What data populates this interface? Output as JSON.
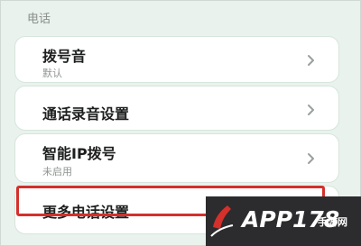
{
  "section": {
    "title": "电话"
  },
  "settings": [
    {
      "title": "拨号音",
      "subtitle": "默认"
    },
    {
      "title": "通话录音设置"
    },
    {
      "title": "智能IP拨号",
      "subtitle": "未启用"
    },
    {
      "title": "更多电话设置"
    }
  ],
  "icons": {
    "chevron": "chevron-right-icon"
  },
  "colors": {
    "background": "#e9f2ed",
    "card": "#ffffff",
    "highlight": "#d4302c",
    "watermark_bg": "#2c2c2e"
  },
  "watermark": {
    "brand": "APP178",
    "suffix": "手游网"
  }
}
